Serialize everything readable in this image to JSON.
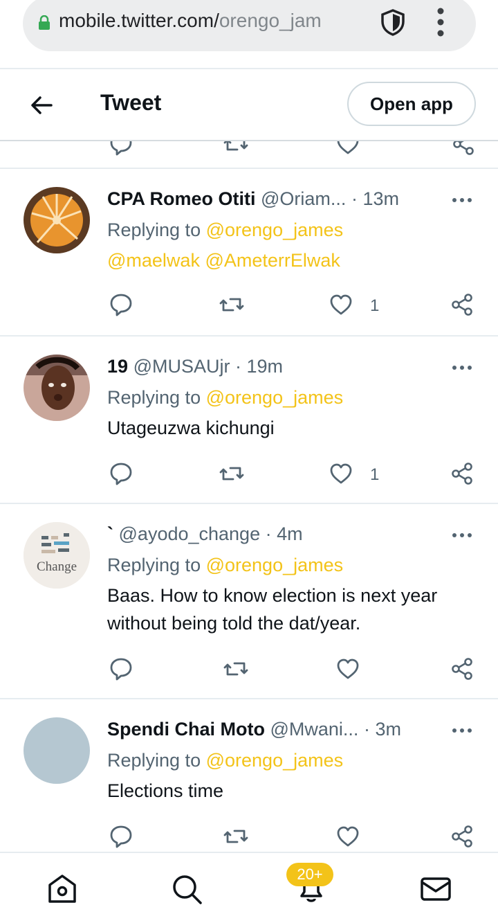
{
  "browser": {
    "url_host": "mobile.twitter.com/",
    "url_path": "orengo_jam"
  },
  "header": {
    "title": "Tweet",
    "open_app_label": "Open app"
  },
  "colors": {
    "mention": "#f3c319",
    "secondary_text": "#536471",
    "primary_text": "#0f1419"
  },
  "tweets": [
    {
      "name": "CPA Romeo Otiti",
      "handle": "@Oriam...",
      "time": "13m",
      "replying_prefix": "Replying to",
      "replying_to": "@orengo_james",
      "mentions_line": "@maelwak @AmeterrElwak",
      "text": "",
      "like_count": "1"
    },
    {
      "name": "19",
      "handle": "@MUSAUjr",
      "time": "19m",
      "replying_prefix": "Replying to",
      "replying_to": "@orengo_james",
      "text": "Utageuzwa kichungi",
      "like_count": "1"
    },
    {
      "name": "`",
      "handle": "@ayodo_change",
      "time": "4m",
      "replying_prefix": "Replying to",
      "replying_to": "@orengo_james",
      "text_line1": "Baas. How to know election is next year",
      "text_line2": "without being told the dat/year.",
      "avatar_label": "Change"
    },
    {
      "name": "Spendi Chai Moto",
      "handle": "@Mwani...",
      "time": "3m",
      "replying_prefix": "Replying to",
      "replying_to": "@orengo_james",
      "text": "Elections time"
    }
  ],
  "bottom_nav": {
    "notifications_badge": "20+"
  },
  "icons": [
    "lock-icon",
    "shield-icon",
    "kebab-menu-icon",
    "back-arrow-icon",
    "reply-icon",
    "retweet-icon",
    "like-icon",
    "share-icon",
    "more-icon",
    "home-icon",
    "search-icon",
    "notifications-icon",
    "messages-icon"
  ]
}
